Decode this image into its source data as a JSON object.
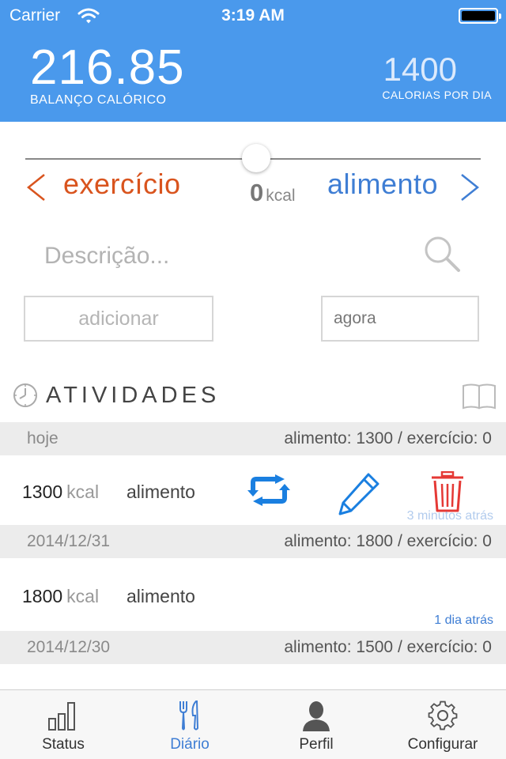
{
  "status_bar": {
    "carrier": "Carrier",
    "time": "3:19 AM"
  },
  "header": {
    "balance_value": "216.85",
    "balance_label": "BALANÇO CALÓRICO",
    "daily_value": "1400",
    "daily_label": "CALORIAS POR DIA"
  },
  "entry_form": {
    "exercise_label": "exercício",
    "food_label": "alimento",
    "kcal_value": "0",
    "kcal_unit": "kcal",
    "slider_position": 0.5,
    "description_placeholder": "Descrição...",
    "add_label": "adicionar",
    "time_value": "agora"
  },
  "activities": {
    "title": "ATIVIDADES",
    "days": [
      {
        "date": "hoje",
        "totals": "alimento: 1300 / exercício: 0"
      },
      {
        "date": "2014/12/31",
        "totals": "alimento: 1800 / exercício: 0"
      },
      {
        "date": "2014/12/30",
        "totals": "alimento: 1500 / exercício: 0"
      }
    ],
    "entries": [
      {
        "kcal": "1300",
        "unit": "kcal",
        "type": "alimento",
        "ago": "3 minutos atrás"
      },
      {
        "kcal": "1800",
        "unit": "kcal",
        "type": "alimento",
        "ago": "1 dia atrás"
      }
    ]
  },
  "tabs": [
    {
      "label": "Status",
      "icon": "bar-chart-icon"
    },
    {
      "label": "Diário",
      "icon": "fork-knife-icon",
      "active": true
    },
    {
      "label": "Perfil",
      "icon": "person-icon"
    },
    {
      "label": "Configurar",
      "icon": "gear-icon"
    }
  ],
  "colors": {
    "header_bg": "#4a99ec",
    "exercise": "#d9541e",
    "food": "#3f7ed4",
    "delete": "#e53935"
  }
}
